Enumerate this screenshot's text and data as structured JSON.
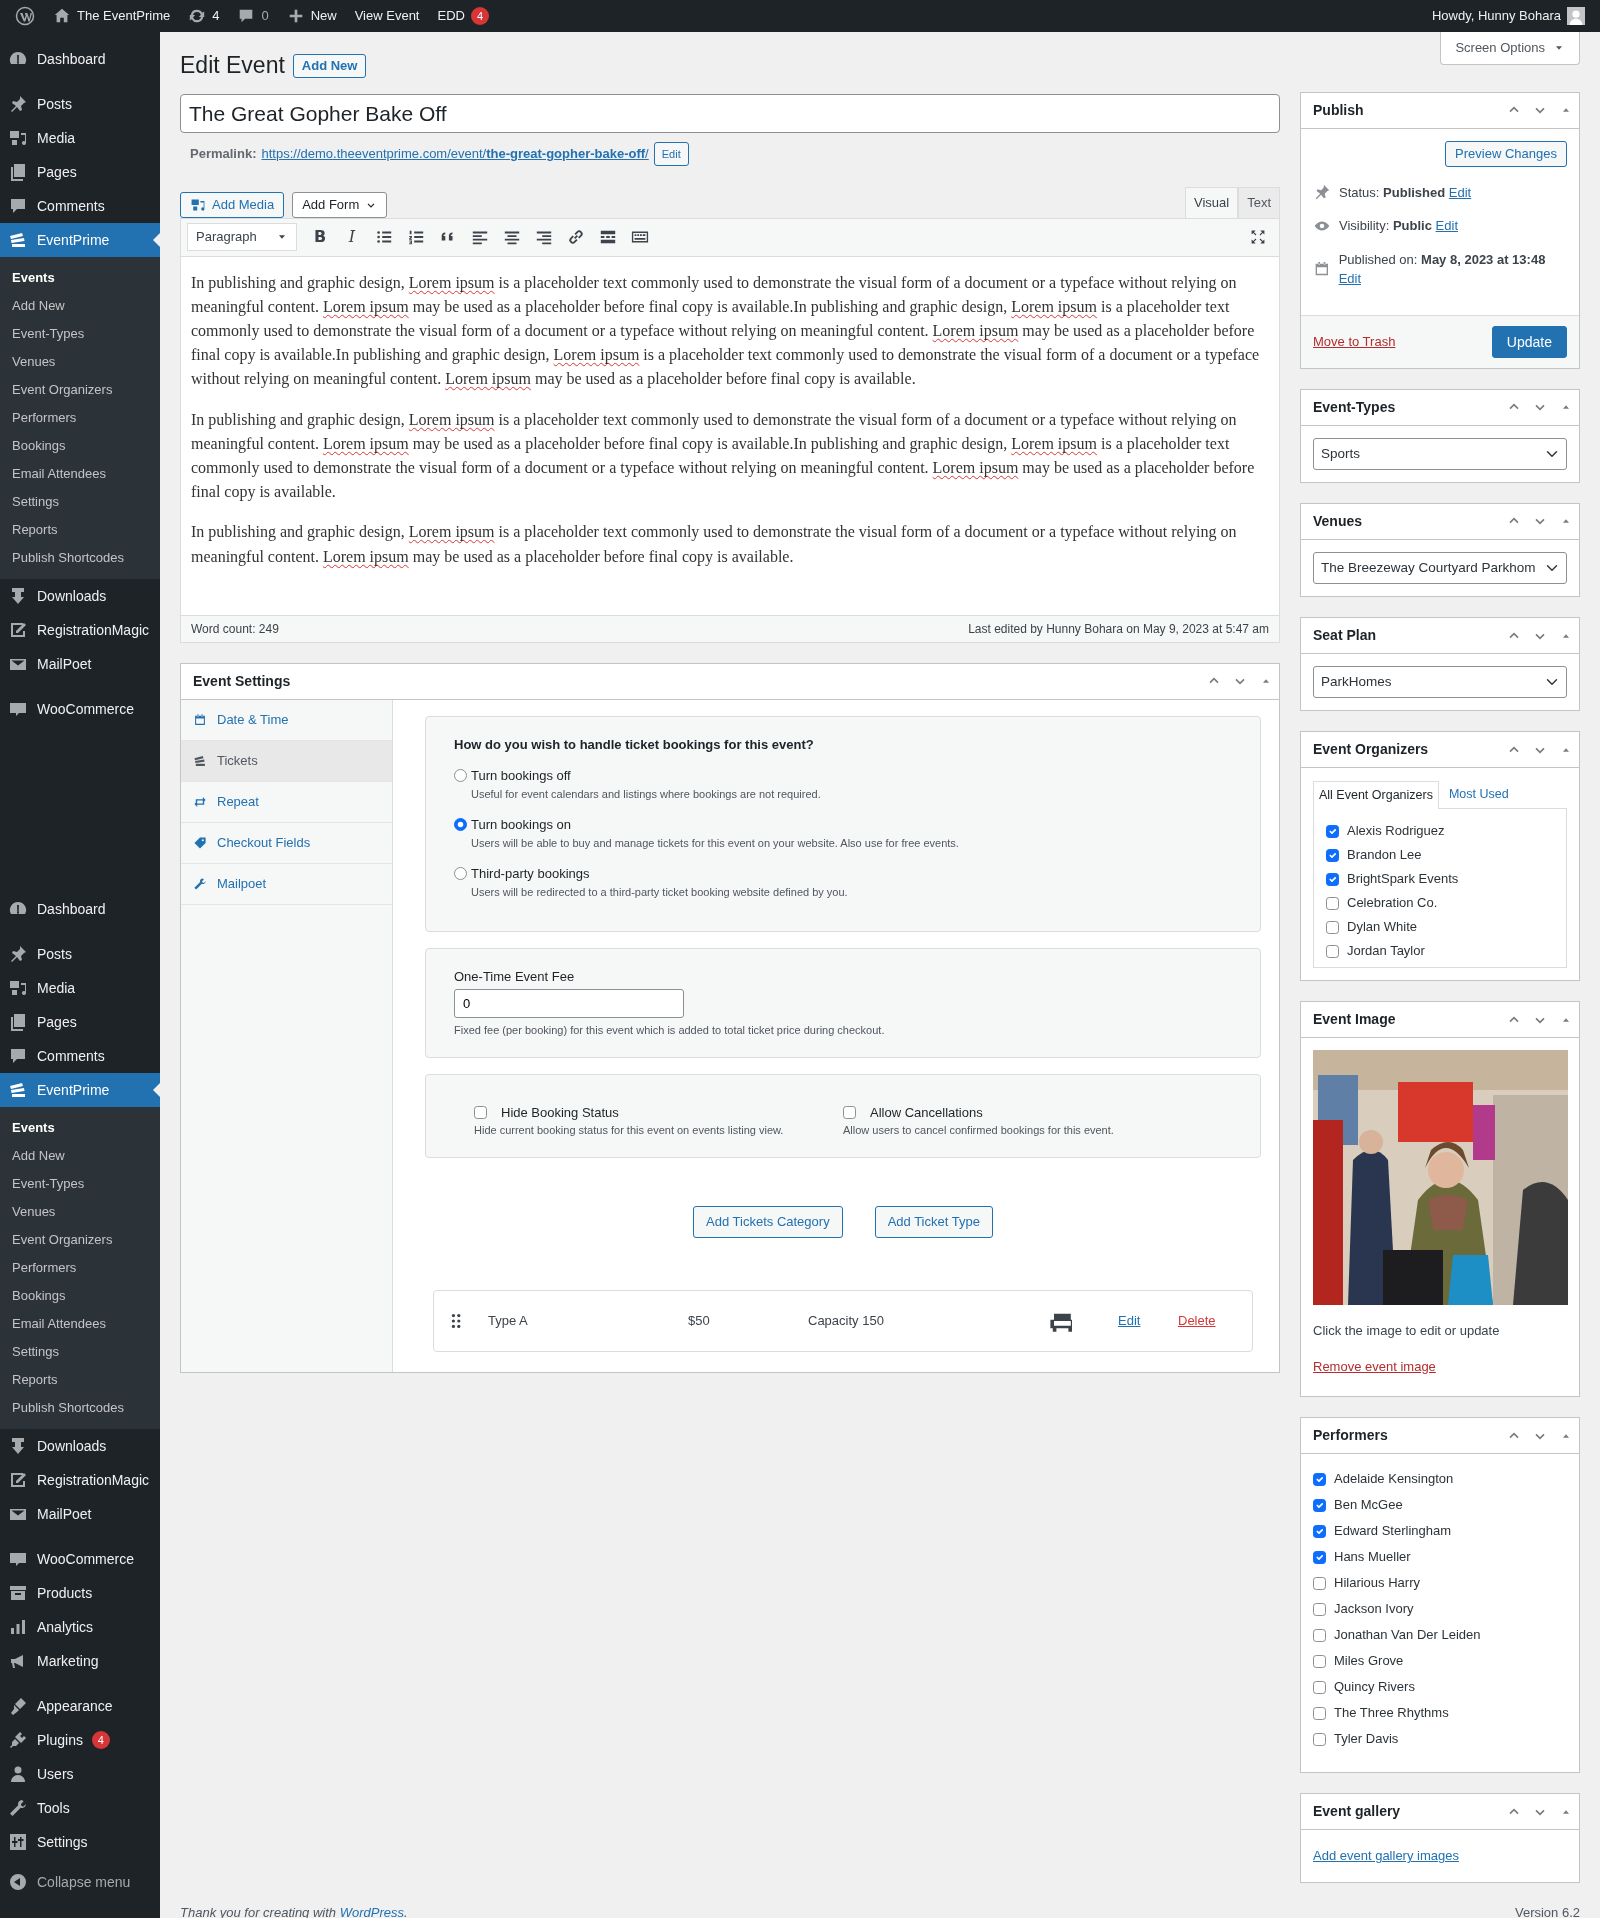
{
  "admin_bar": {
    "site": "The EventPrime",
    "updates": "4",
    "comments": "0",
    "new": "New",
    "view": "View Event",
    "edd": "EDD",
    "edd_badge": "4",
    "account": "Howdy, Hunny Bohara"
  },
  "sidebar": {
    "menus": [
      {
        "groups": [
          [
            {
              "label": "Dashboard",
              "kind": "dashboard",
              "selected": false
            }
          ],
          [
            {
              "label": "Posts",
              "kind": "posts",
              "selected": false
            },
            {
              "label": "Media",
              "kind": "media",
              "selected": false
            },
            {
              "label": "Pages",
              "kind": "pages",
              "selected": false
            },
            {
              "label": "Comments",
              "kind": "comments",
              "selected": false
            },
            {
              "label": "EventPrime",
              "kind": "eventprime",
              "selected": true,
              "submenu": [
                {
                  "label": "Events",
                  "selected": true
                },
                {
                  "label": "Add New",
                  "selected": false
                },
                {
                  "label": "Event-Types",
                  "selected": false
                },
                {
                  "label": "Venues",
                  "selected": false
                },
                {
                  "label": "Event Organizers",
                  "selected": false
                },
                {
                  "label": "Performers",
                  "selected": false
                },
                {
                  "label": "Bookings",
                  "selected": false
                },
                {
                  "label": "Email Attendees",
                  "selected": false
                },
                {
                  "label": "Settings",
                  "selected": false
                },
                {
                  "label": "Reports",
                  "selected": false
                },
                {
                  "label": "Publish Shortcodes",
                  "selected": false
                }
              ]
            },
            {
              "label": "Downloads",
              "kind": "downloads",
              "selected": false
            },
            {
              "label": "RegistrationMagic",
              "kind": "registration",
              "selected": false
            },
            {
              "label": "MailPoet",
              "kind": "mailpoet",
              "selected": false
            }
          ],
          [
            {
              "label": "WooCommerce",
              "kind": "woocommerce",
              "selected": false
            }
          ]
        ]
      },
      {
        "groups": [
          [
            {
              "label": "Dashboard",
              "kind": "dashboard",
              "selected": false
            }
          ],
          [
            {
              "label": "Posts",
              "kind": "posts",
              "selected": false
            },
            {
              "label": "Media",
              "kind": "media",
              "selected": false
            },
            {
              "label": "Pages",
              "kind": "pages",
              "selected": false
            },
            {
              "label": "Comments",
              "kind": "comments",
              "selected": false
            },
            {
              "label": "EventPrime",
              "kind": "eventprime",
              "selected": true,
              "submenu": [
                {
                  "label": "Events",
                  "selected": true
                },
                {
                  "label": "Add New",
                  "selected": false
                },
                {
                  "label": "Event-Types",
                  "selected": false
                },
                {
                  "label": "Venues",
                  "selected": false
                },
                {
                  "label": "Event Organizers",
                  "selected": false
                },
                {
                  "label": "Performers",
                  "selected": false
                },
                {
                  "label": "Bookings",
                  "selected": false
                },
                {
                  "label": "Email Attendees",
                  "selected": false
                },
                {
                  "label": "Settings",
                  "selected": false
                },
                {
                  "label": "Reports",
                  "selected": false
                },
                {
                  "label": "Publish Shortcodes",
                  "selected": false
                }
              ]
            },
            {
              "label": "Downloads",
              "kind": "downloads",
              "selected": false
            },
            {
              "label": "RegistrationMagic",
              "kind": "registration",
              "selected": false
            },
            {
              "label": "MailPoet",
              "kind": "mailpoet",
              "selected": false
            }
          ],
          [
            {
              "label": "WooCommerce",
              "kind": "woocommerce",
              "selected": false
            },
            {
              "label": "Products",
              "kind": "products",
              "selected": false
            },
            {
              "label": "Analytics",
              "kind": "analytics",
              "selected": false
            },
            {
              "label": "Marketing",
              "kind": "marketing",
              "selected": false
            }
          ],
          [
            {
              "label": "Appearance",
              "kind": "appearance",
              "selected": false
            },
            {
              "label": "Plugins",
              "kind": "plugins",
              "selected": false,
              "badge": "4"
            },
            {
              "label": "Users",
              "kind": "users",
              "selected": false
            },
            {
              "label": "Tools",
              "kind": "tools",
              "selected": false
            },
            {
              "label": "Settings",
              "kind": "settings",
              "selected": false
            }
          ]
        ]
      }
    ],
    "collapse": "Collapse menu"
  },
  "page": {
    "title": "Edit Event",
    "add_new": "Add New",
    "screen_options": "Screen Options"
  },
  "post_title": "The Great Gopher Bake Off",
  "permalink": {
    "label": "Permalink:",
    "url": "https://demo.theeventprime.com/event/**the-great-gopher-bake-off**/",
    "edit": "Edit"
  },
  "editor": {
    "add_media": "Add Media",
    "add_form": "Add Form",
    "tabs": [
      {
        "label": "Visual",
        "selected": true
      },
      {
        "label": "Text",
        "selected": false
      }
    ],
    "format": "Paragraph",
    "toolbar": [
      {
        "kind": "bold",
        "glyph": "B"
      },
      {
        "kind": "italic",
        "glyph": "I"
      },
      {
        "kind": "bullets"
      },
      {
        "kind": "numbers"
      },
      {
        "kind": "quote"
      },
      {
        "kind": "align-left"
      },
      {
        "kind": "align-center"
      },
      {
        "kind": "align-right"
      },
      {
        "kind": "link"
      },
      {
        "kind": "more"
      },
      {
        "kind": "kitchen"
      }
    ],
    "paragraphs": [
      [
        {
          "text": "In publishing and graphic design, ",
          "misspelled": false
        },
        {
          "text": "Lorem ipsum",
          "misspelled": true
        },
        {
          "text": " is a placeholder text commonly used to demonstrate the visual form of a document or a typeface without relying on meaningful content. ",
          "misspelled": false
        },
        {
          "text": "Lorem ipsum",
          "misspelled": true
        },
        {
          "text": " may be used as a placeholder before final copy is available.In publishing and graphic design, ",
          "misspelled": false
        },
        {
          "text": "Lorem ipsum",
          "misspelled": true
        },
        {
          "text": " is a placeholder text commonly used to demonstrate the visual form of a document or a typeface without relying on meaningful content. ",
          "misspelled": false
        },
        {
          "text": "Lorem ipsum",
          "misspelled": true
        },
        {
          "text": " may be used as a placeholder before final copy is available.In publishing and graphic design, ",
          "misspelled": false
        },
        {
          "text": "Lorem ipsum",
          "misspelled": true
        },
        {
          "text": " is a placeholder text commonly used to demonstrate the visual form of a document or a typeface without relying on meaningful content. ",
          "misspelled": false
        },
        {
          "text": "Lorem ipsum",
          "misspelled": true
        },
        {
          "text": " may be used as a placeholder before final copy is available.",
          "misspelled": false
        }
      ],
      [
        {
          "text": "In publishing and graphic design, ",
          "misspelled": false
        },
        {
          "text": "Lorem ipsum",
          "misspelled": true
        },
        {
          "text": " is a placeholder text commonly used to demonstrate the visual form of a document or a typeface without relying on meaningful content. ",
          "misspelled": false
        },
        {
          "text": "Lorem ipsum",
          "misspelled": true
        },
        {
          "text": " may be used as a placeholder before final copy is available.In publishing and graphic design, ",
          "misspelled": false
        },
        {
          "text": "Lorem ipsum",
          "misspelled": true
        },
        {
          "text": " is a placeholder text commonly used to demonstrate the visual form of a document or a typeface without relying on meaningful content. ",
          "misspelled": false
        },
        {
          "text": "Lorem ipsum",
          "misspelled": true
        },
        {
          "text": " may be used as a placeholder before final copy is available.",
          "misspelled": false
        }
      ],
      [
        {
          "text": "In publishing and graphic design, ",
          "misspelled": false
        },
        {
          "text": "Lorem ipsum",
          "misspelled": true
        },
        {
          "text": " is a placeholder text commonly used to demonstrate the visual form of a document or a typeface without relying on meaningful content. ",
          "misspelled": false
        },
        {
          "text": "Lorem ipsum",
          "misspelled": true
        },
        {
          "text": " may be used as a placeholder before final copy is available.",
          "misspelled": false
        }
      ]
    ],
    "word_count": "Word count: 249",
    "last_edited": "Last edited by Hunny Bohara on May 9, 2023 at 5:47 am"
  },
  "event_settings": {
    "title": "Event Settings",
    "tabs": [
      {
        "label": "Date & Time",
        "kind": "calendar",
        "selected": false
      },
      {
        "label": "Tickets",
        "kind": "tickets",
        "selected": true
      },
      {
        "label": "Repeat",
        "kind": "repeat",
        "selected": false
      },
      {
        "label": "Checkout Fields",
        "kind": "tag",
        "selected": false
      },
      {
        "label": "Mailpoet",
        "kind": "wrench",
        "selected": false
      }
    ],
    "question": "How do you wish to handle ticket bookings for this event?",
    "options": [
      {
        "label": "Turn bookings off",
        "description": "Useful for event calendars and listings where bookings are not required.",
        "selected": false
      },
      {
        "label": "Turn bookings on",
        "description": "Users will be able to buy and manage tickets for this event on your website. Also use for free events.",
        "selected": true
      },
      {
        "label": "Third-party bookings",
        "description": "Users will be redirected to a third-party ticket booking website defined by you.",
        "selected": false
      }
    ],
    "fee": {
      "label": "One-Time Event Fee",
      "value": "0",
      "help": "Fixed fee (per booking) for this event which is added to total ticket price during checkout."
    },
    "toggles": [
      {
        "label": "Hide Booking Status",
        "description": "Hide current booking status for this event on events listing view.",
        "checked": false
      },
      {
        "label": "Allow Cancellations",
        "description": "Allow users to cancel confirmed bookings for this event.",
        "checked": false
      }
    ],
    "buttons": [
      "Add Tickets Category",
      "Add Ticket Type"
    ],
    "tickets": [
      {
        "name": "Type A",
        "price": "$50",
        "capacity": "Capacity 150",
        "edit": "Edit",
        "delete": "Delete"
      }
    ]
  },
  "publish": {
    "title": "Publish",
    "preview": "Preview Changes",
    "rows": [
      {
        "kind": "status",
        "text": "Status: **Published**",
        "link": "Edit"
      },
      {
        "kind": "visibility",
        "text": "Visibility: **Public**",
        "link": "Edit"
      },
      {
        "kind": "date",
        "text": "Published on: **May 8, 2023 at 13:48**",
        "link": "Edit"
      }
    ],
    "trash": "Move to Trash",
    "update": "Update"
  },
  "event_types": {
    "title": "Event-Types",
    "value": "Sports"
  },
  "venues": {
    "title": "Venues",
    "value": "The Breezeway Courtyard Parkhom"
  },
  "seat_plan": {
    "title": "Seat Plan",
    "value": "ParkHomes"
  },
  "organizers": {
    "title": "Event Organizers",
    "tabs": [
      {
        "label": "All Event Organizers",
        "selected": true
      },
      {
        "label": "Most Used",
        "selected": false
      }
    ],
    "items": [
      {
        "label": "Alexis Rodriguez",
        "checked": true
      },
      {
        "label": "Brandon Lee",
        "checked": true
      },
      {
        "label": "BrightSpark Events",
        "checked": true
      },
      {
        "label": "Celebration Co.",
        "checked": false
      },
      {
        "label": "Dylan White",
        "checked": false
      },
      {
        "label": "Jordan Taylor",
        "checked": false
      }
    ]
  },
  "event_image": {
    "title": "Event Image",
    "hint": "Click the image to edit or update",
    "remove": "Remove event image"
  },
  "performers": {
    "title": "Performers",
    "items": [
      {
        "label": "Adelaide Kensington",
        "checked": true
      },
      {
        "label": "Ben McGee",
        "checked": true
      },
      {
        "label": "Edward Sterlingham",
        "checked": true
      },
      {
        "label": "Hans Mueller",
        "checked": true
      },
      {
        "label": "Hilarious Harry",
        "checked": false
      },
      {
        "label": "Jackson Ivory",
        "checked": false
      },
      {
        "label": "Jonathan Van Der Leiden",
        "checked": false
      },
      {
        "label": "Miles Grove",
        "checked": false
      },
      {
        "label": "Quincy Rivers",
        "checked": false
      },
      {
        "label": "The Three Rhythms",
        "checked": false
      },
      {
        "label": "Tyler Davis",
        "checked": false
      }
    ]
  },
  "gallery": {
    "title": "Event gallery",
    "link": "Add event gallery images"
  },
  "footer": {
    "before": "Thank you for creating with ",
    "link": "WordPress",
    "after": ".",
    "version": "Version 6.2"
  }
}
